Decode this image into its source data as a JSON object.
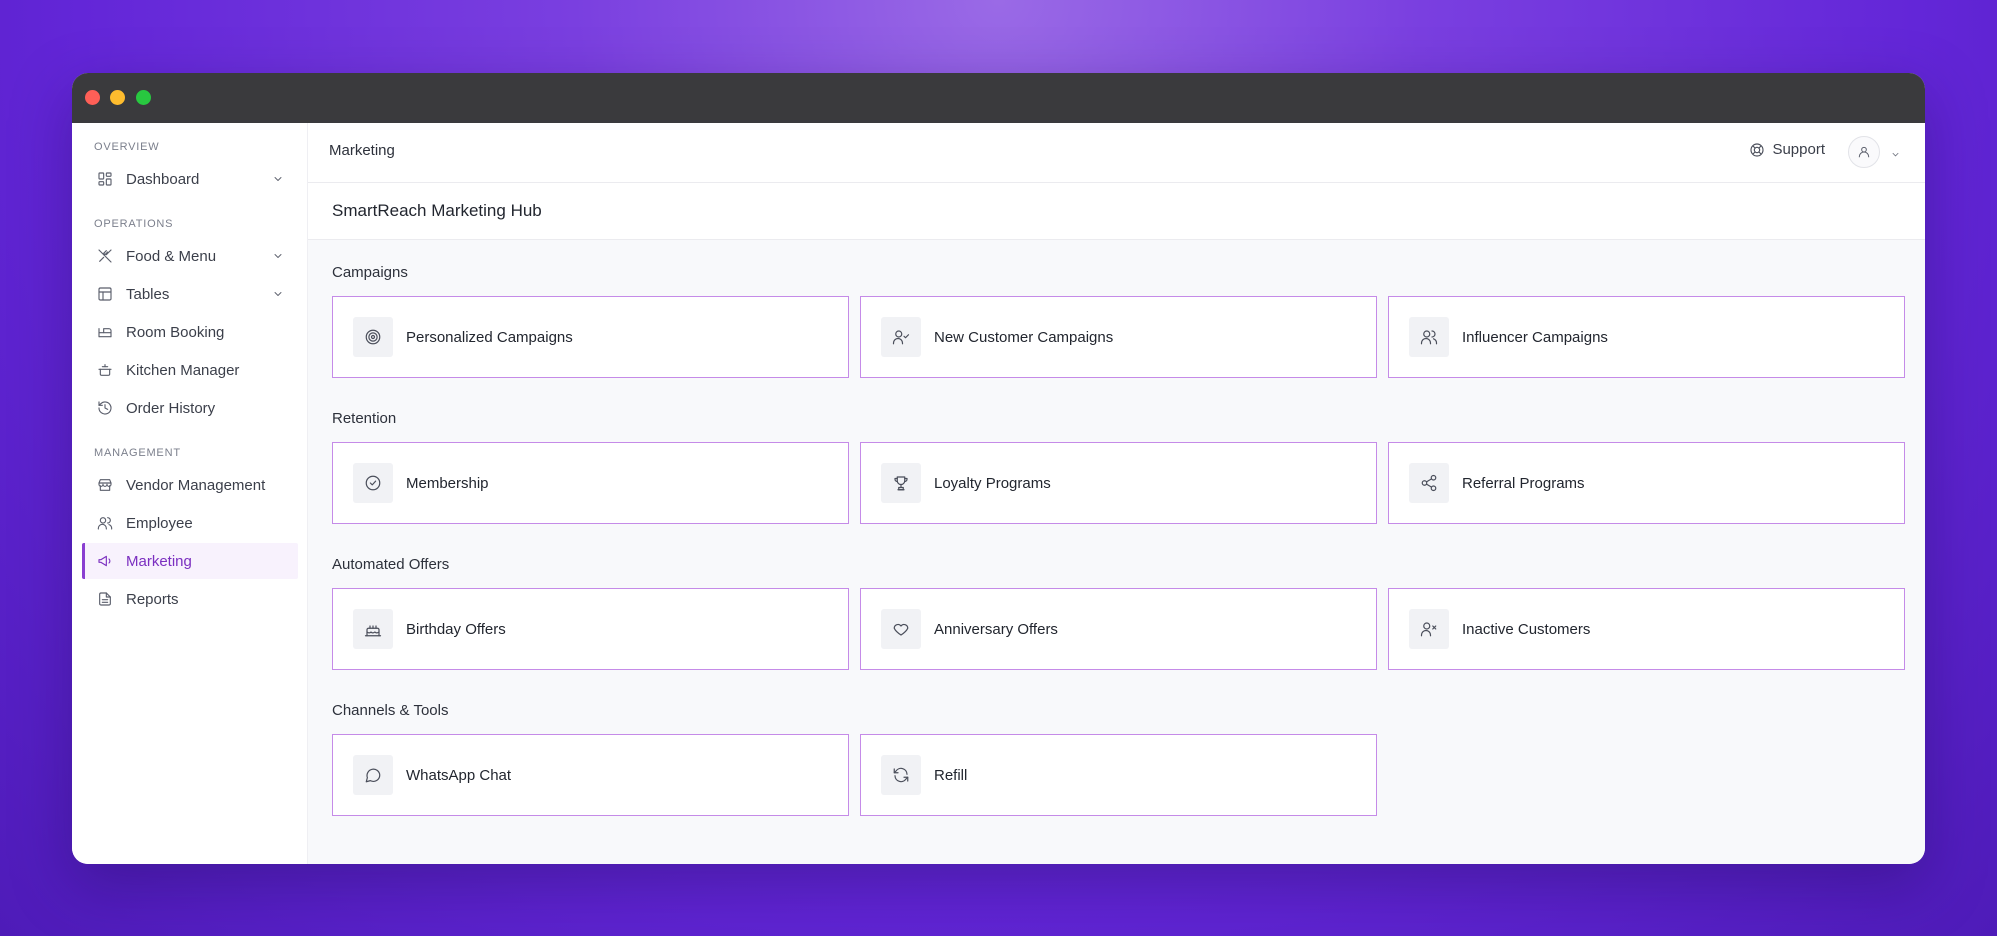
{
  "sidebar": {
    "sections": [
      {
        "label": "OVERVIEW"
      },
      {
        "label": "OPERATIONS"
      },
      {
        "label": "MANAGEMENT"
      }
    ],
    "items": [
      {
        "label": "Dashboard",
        "icon": "grid-icon"
      },
      {
        "label": "Food & Menu",
        "icon": "utensils-icon"
      },
      {
        "label": "Tables",
        "icon": "table-icon"
      },
      {
        "label": "Room Booking",
        "icon": "bed-icon"
      },
      {
        "label": "Kitchen Manager",
        "icon": "cooking-pot-icon"
      },
      {
        "label": "Order History",
        "icon": "history-icon"
      },
      {
        "label": "Vendor Management",
        "icon": "store-icon"
      },
      {
        "label": "Employee",
        "icon": "users-icon"
      },
      {
        "label": "Marketing",
        "icon": "megaphone-icon"
      },
      {
        "label": "Reports",
        "icon": "file-text-icon"
      }
    ],
    "active": "Marketing"
  },
  "header": {
    "breadcrumb": "Marketing",
    "support_label": "Support"
  },
  "hub": {
    "title": "SmartReach Marketing Hub"
  },
  "groups": [
    {
      "label": "Campaigns",
      "cards": [
        {
          "label": "Personalized Campaigns",
          "icon": "target-icon"
        },
        {
          "label": "New Customer Campaigns",
          "icon": "user-check-icon"
        },
        {
          "label": "Influencer Campaigns",
          "icon": "users-icon"
        }
      ]
    },
    {
      "label": "Retention",
      "cards": [
        {
          "label": "Membership",
          "icon": "circle-check-icon"
        },
        {
          "label": "Loyalty Programs",
          "icon": "trophy-icon"
        },
        {
          "label": "Referral Programs",
          "icon": "share-icon"
        }
      ]
    },
    {
      "label": "Automated Offers",
      "cards": [
        {
          "label": "Birthday Offers",
          "icon": "cake-icon"
        },
        {
          "label": "Anniversary Offers",
          "icon": "heart-icon"
        },
        {
          "label": "Inactive Customers",
          "icon": "user-x-icon"
        }
      ]
    },
    {
      "label": "Channels & Tools",
      "cards": [
        {
          "label": "WhatsApp Chat",
          "icon": "message-circle-icon"
        },
        {
          "label": "Refill",
          "icon": "refresh-icon"
        }
      ]
    }
  ],
  "colors": {
    "accent": "#8a3fd1",
    "card_border": "#c58be8",
    "active_bg": "#f8f2fd"
  }
}
